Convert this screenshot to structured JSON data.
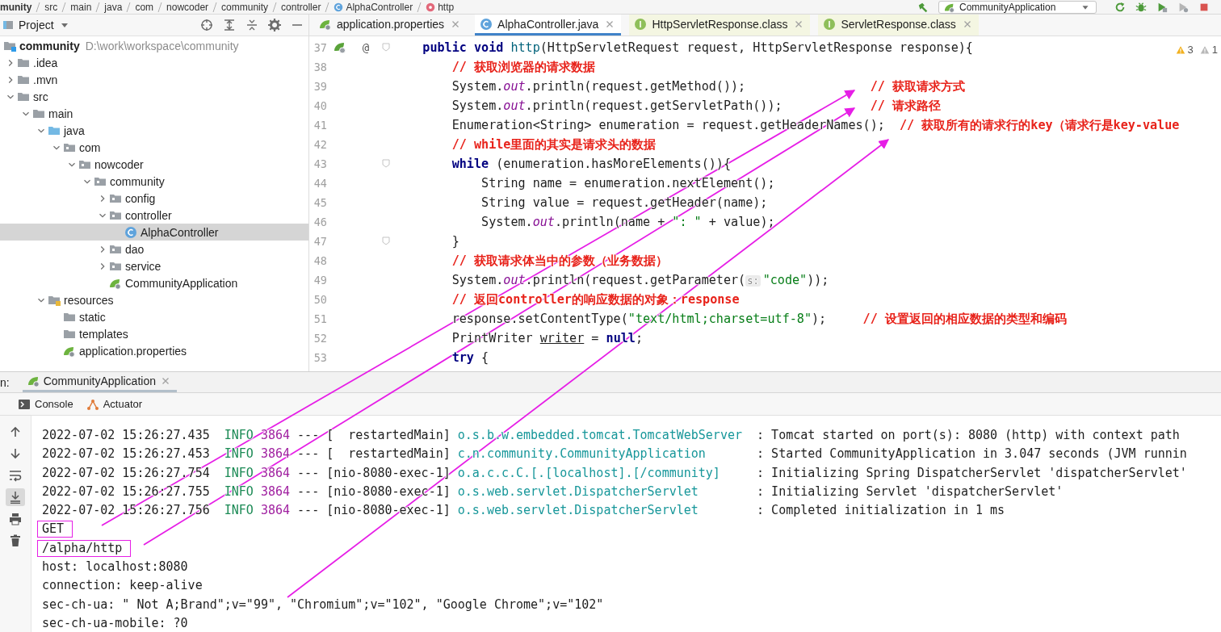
{
  "breadcrumb": [
    {
      "label": "munity",
      "kind": "module"
    },
    {
      "label": "src",
      "kind": "folder"
    },
    {
      "label": "main",
      "kind": "folder"
    },
    {
      "label": "java",
      "kind": "folder"
    },
    {
      "label": "com",
      "kind": "folder"
    },
    {
      "label": "nowcoder",
      "kind": "folder"
    },
    {
      "label": "community",
      "kind": "folder"
    },
    {
      "label": "controller",
      "kind": "folder"
    },
    {
      "label": "AlphaController",
      "kind": "class"
    },
    {
      "label": "http",
      "kind": "method"
    }
  ],
  "toolbar": [
    {
      "kind": "build"
    },
    {
      "kind": "run_config",
      "label": "CommunityApplication"
    },
    {
      "kind": "rerun"
    },
    {
      "kind": "debug"
    },
    {
      "kind": "coverage"
    },
    {
      "kind": "profile"
    },
    {
      "kind": "stop"
    }
  ],
  "project": {
    "title": "Project",
    "tree": [
      {
        "label": "community",
        "path": "D:\\work\\workspace\\community",
        "kind": "module",
        "selected": false,
        "children": [
          {
            "label": ".idea",
            "kind": "folder",
            "expanded": false,
            "selected": false
          },
          {
            "label": ".mvn",
            "kind": "folder",
            "expanded": false,
            "selected": false
          },
          {
            "label": "src",
            "kind": "folder",
            "expanded": true,
            "selected": false,
            "children": [
              {
                "label": "main",
                "kind": "folder",
                "expanded": true,
                "selected": false,
                "children": [
                  {
                    "label": "java",
                    "kind": "srcfolder",
                    "expanded": true,
                    "selected": false,
                    "children": [
                      {
                        "label": "com",
                        "kind": "package",
                        "expanded": true,
                        "selected": false,
                        "children": [
                          {
                            "label": "nowcoder",
                            "kind": "package",
                            "expanded": true,
                            "selected": false,
                            "children": [
                              {
                                "label": "community",
                                "kind": "package",
                                "expanded": true,
                                "selected": false,
                                "children": [
                                  {
                                    "label": "config",
                                    "kind": "package",
                                    "expanded": false,
                                    "selected": false
                                  },
                                  {
                                    "label": "controller",
                                    "kind": "package",
                                    "expanded": true,
                                    "selected": false,
                                    "children": [
                                      {
                                        "label": "AlphaController",
                                        "kind": "class",
                                        "selected": true
                                      }
                                    ]
                                  },
                                  {
                                    "label": "dao",
                                    "kind": "package",
                                    "expanded": false,
                                    "selected": false
                                  },
                                  {
                                    "label": "service",
                                    "kind": "package",
                                    "expanded": false,
                                    "selected": false
                                  },
                                  {
                                    "label": "CommunityApplication",
                                    "kind": "spring",
                                    "selected": false
                                  }
                                ]
                              }
                            ]
                          }
                        ]
                      }
                    ]
                  },
                  {
                    "label": "resources",
                    "kind": "resources",
                    "expanded": true,
                    "selected": false,
                    "children": [
                      {
                        "label": "static",
                        "kind": "folder",
                        "selected": false
                      },
                      {
                        "label": "templates",
                        "kind": "folder",
                        "selected": false
                      },
                      {
                        "label": "application.properties",
                        "kind": "properties",
                        "selected": false
                      }
                    ]
                  }
                ]
              }
            ]
          }
        ]
      }
    ]
  },
  "editor": {
    "tabs": [
      {
        "label": "application.properties",
        "kind": "properties",
        "selected": false
      },
      {
        "label": "AlphaController.java",
        "kind": "class",
        "selected": true
      },
      {
        "label": "HttpServletResponse.class",
        "kind": "interface",
        "selected": false
      },
      {
        "label": "ServletResponse.class",
        "kind": "interface",
        "selected": false
      }
    ],
    "inspections": [
      {
        "kind": "warning",
        "count": "3"
      },
      {
        "kind": "weak_warning",
        "count": "1"
      }
    ],
    "lines": [
      {
        "number": "37",
        "markers": [
          {
            "kind": "run"
          },
          {
            "kind": "override",
            "text": "@"
          }
        ],
        "fold": true,
        "tokens": [
          {
            "kind": "kw",
            "text": "    public void "
          },
          {
            "kind": "decl",
            "text": "http"
          },
          {
            "kind": "plain",
            "text": "(HttpServletRequest request, HttpServletResponse response){"
          }
        ]
      },
      {
        "number": "38",
        "tokens": [
          {
            "kind": "comment",
            "text": "        // 获取浏览器的请求数据"
          }
        ]
      },
      {
        "number": "39",
        "tokens": [
          {
            "kind": "plain",
            "text": "        System."
          },
          {
            "kind": "field",
            "text": "out"
          },
          {
            "kind": "plain",
            "text": ".println(request.getMethod());                 "
          },
          {
            "kind": "comment",
            "text": "// 获取请求方式"
          }
        ]
      },
      {
        "number": "40",
        "tokens": [
          {
            "kind": "plain",
            "text": "        System."
          },
          {
            "kind": "field",
            "text": "out"
          },
          {
            "kind": "plain",
            "text": ".println(request.getServletPath());            "
          },
          {
            "kind": "comment",
            "text": "// 请求路径"
          }
        ]
      },
      {
        "number": "41",
        "tokens": [
          {
            "kind": "plain",
            "text": "        Enumeration<String> enumeration = request.getHeaderNames();  "
          },
          {
            "kind": "comment",
            "text": "// 获取所有的请求行的key（请求行是key-value"
          }
        ]
      },
      {
        "number": "42",
        "tokens": [
          {
            "kind": "comment",
            "text": "        // while里面的其实是请求头的数据"
          }
        ]
      },
      {
        "number": "43",
        "fold": true,
        "tokens": [
          {
            "kind": "kw",
            "text": "        while"
          },
          {
            "kind": "plain",
            "text": " (enumeration.hasMoreElements()){"
          }
        ]
      },
      {
        "number": "44",
        "tokens": [
          {
            "kind": "plain",
            "text": "            String name = enumeration.nextElement();"
          }
        ]
      },
      {
        "number": "45",
        "tokens": [
          {
            "kind": "plain",
            "text": "            String value = request.getHeader(name);"
          }
        ]
      },
      {
        "number": "46",
        "tokens": [
          {
            "kind": "plain",
            "text": "            System."
          },
          {
            "kind": "field",
            "text": "out"
          },
          {
            "kind": "plain",
            "text": ".println(name + "
          },
          {
            "kind": "str",
            "text": "\": \""
          },
          {
            "kind": "plain",
            "text": " + value);"
          }
        ]
      },
      {
        "number": "47",
        "fold": true,
        "tokens": [
          {
            "kind": "plain",
            "text": "        }"
          }
        ]
      },
      {
        "number": "48",
        "tokens": [
          {
            "kind": "comment",
            "text": "        // 获取请求体当中的参数（业务数据）"
          }
        ]
      },
      {
        "number": "49",
        "tokens": [
          {
            "kind": "plain",
            "text": "        System."
          },
          {
            "kind": "field",
            "text": "out"
          },
          {
            "kind": "plain",
            "text": ".println(request.getParameter("
          },
          {
            "kind": "hint",
            "text": "s:"
          },
          {
            "kind": "str",
            "text": "\"code\""
          },
          {
            "kind": "plain",
            "text": "));"
          }
        ]
      },
      {
        "number": "50",
        "tokens": [
          {
            "kind": "comment",
            "text": "        // 返回controller的响应数据的对象：response"
          }
        ]
      },
      {
        "number": "51",
        "tokens": [
          {
            "kind": "plain",
            "text": "        response.setContentType("
          },
          {
            "kind": "str",
            "text": "\"text/html;charset=utf-8\""
          },
          {
            "kind": "plain",
            "text": ");     "
          },
          {
            "kind": "comment",
            "text": "// 设置返回的相应数据的类型和编码"
          }
        ]
      },
      {
        "number": "52",
        "tokens": [
          {
            "kind": "plain",
            "text": "        PrintWriter "
          },
          {
            "kind": "underline",
            "text": "writer"
          },
          {
            "kind": "plain",
            "text": " = "
          },
          {
            "kind": "kw",
            "text": "null"
          },
          {
            "kind": "plain",
            "text": ";"
          }
        ]
      },
      {
        "number": "53",
        "tokens": [
          {
            "kind": "kw",
            "text": "        try"
          },
          {
            "kind": "plain",
            "text": " {"
          }
        ]
      }
    ]
  },
  "run": {
    "label": "n:",
    "tabs": [
      {
        "label": "CommunityApplication",
        "kind": "spring"
      }
    ],
    "subtabs": [
      {
        "label": "Console",
        "kind": "console"
      },
      {
        "label": "Actuator",
        "kind": "actuator"
      }
    ],
    "toolbar": [
      {
        "kind": "up",
        "selected": false
      },
      {
        "kind": "down",
        "selected": false
      },
      {
        "kind": "wrap",
        "selected": false
      },
      {
        "kind": "scroll_end",
        "selected": true
      },
      {
        "kind": "print",
        "selected": false
      },
      {
        "kind": "trash",
        "selected": false
      }
    ],
    "lines": [
      {
        "kind": "log",
        "tokens": [
          {
            "kind": "plain",
            "text": "2022-07-02 15:26:27.435  "
          },
          {
            "kind": "level",
            "text": "INFO"
          },
          {
            "kind": "pid",
            "text": " 3864"
          },
          {
            "kind": "plain",
            "text": " --- [  restartedMain] "
          },
          {
            "kind": "logger",
            "text": "o.s.b.w.embedded.tomcat.TomcatWebServer"
          },
          {
            "kind": "plain",
            "text": "  : Tomcat started on port(s): 8080 (http) with context path"
          }
        ]
      },
      {
        "kind": "log",
        "tokens": [
          {
            "kind": "plain",
            "text": "2022-07-02 15:26:27.453  "
          },
          {
            "kind": "level",
            "text": "INFO"
          },
          {
            "kind": "pid",
            "text": " 3864"
          },
          {
            "kind": "plain",
            "text": " --- [  restartedMain] "
          },
          {
            "kind": "logger",
            "text": "c.n.community.CommunityApplication"
          },
          {
            "kind": "plain",
            "text": "       : Started CommunityApplication in 3.047 seconds (JVM runnin"
          }
        ]
      },
      {
        "kind": "log",
        "tokens": [
          {
            "kind": "plain",
            "text": "2022-07-02 15:26:27.754  "
          },
          {
            "kind": "level",
            "text": "INFO"
          },
          {
            "kind": "pid",
            "text": " 3864"
          },
          {
            "kind": "plain",
            "text": " --- [nio-8080-exec-1] "
          },
          {
            "kind": "logger",
            "text": "o.a.c.c.C.[.[localhost].[/community]"
          },
          {
            "kind": "plain",
            "text": "     : Initializing Spring DispatcherServlet 'dispatcherServlet'"
          }
        ]
      },
      {
        "kind": "log",
        "tokens": [
          {
            "kind": "plain",
            "text": "2022-07-02 15:26:27.755  "
          },
          {
            "kind": "level",
            "text": "INFO"
          },
          {
            "kind": "pid",
            "text": " 3864"
          },
          {
            "kind": "plain",
            "text": " --- [nio-8080-exec-1] "
          },
          {
            "kind": "logger",
            "text": "o.s.web.servlet.DispatcherServlet"
          },
          {
            "kind": "plain",
            "text": "        : Initializing Servlet 'dispatcherServlet'"
          }
        ]
      },
      {
        "kind": "log",
        "tokens": [
          {
            "kind": "plain",
            "text": "2022-07-02 15:26:27.756  "
          },
          {
            "kind": "level",
            "text": "INFO"
          },
          {
            "kind": "pid",
            "text": " 3864"
          },
          {
            "kind": "plain",
            "text": " --- [nio-8080-exec-1] "
          },
          {
            "kind": "logger",
            "text": "o.s.web.servlet.DispatcherServlet"
          },
          {
            "kind": "plain",
            "text": "        : Completed initialization in 1 ms"
          }
        ]
      },
      {
        "kind": "output",
        "text": "GET",
        "boxed": true
      },
      {
        "kind": "output",
        "text": "/alpha/http",
        "boxed": true
      },
      {
        "kind": "output",
        "text": "host: localhost:8080",
        "boxed": false
      },
      {
        "kind": "output",
        "text": "connection: keep-alive",
        "boxed": false
      },
      {
        "kind": "output",
        "text": "sec-ch-ua: \" Not A;Brand\";v=\"99\", \"Chromium\";v=\"102\", \"Google Chrome\";v=\"102\"",
        "boxed": false
      },
      {
        "kind": "output",
        "text": "sec-ch-ua-mobile: ?0",
        "boxed": false
      }
    ]
  }
}
